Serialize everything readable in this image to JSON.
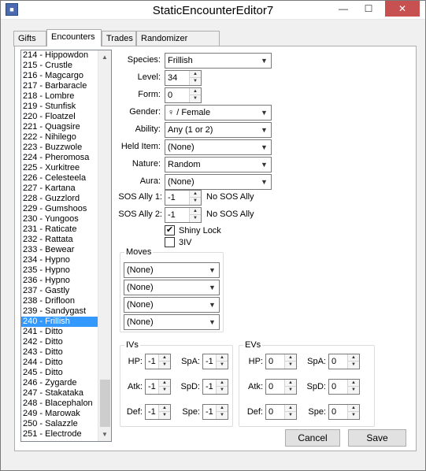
{
  "window": {
    "title": "StaticEncounterEditor7",
    "minimize": "—",
    "maximize": "☐",
    "close": "✕",
    "icon": "app-icon"
  },
  "tabs": [
    {
      "label": "Gifts"
    },
    {
      "label": "Encounters"
    },
    {
      "label": "Trades"
    },
    {
      "label": "Randomizer Options"
    }
  ],
  "encounter_list": [
    "214 - Hippowdon",
    "215 - Crustle",
    "216 - Magcargo",
    "217 - Barbaracle",
    "218 - Lombre",
    "219 - Stunfisk",
    "220 - Floatzel",
    "221 - Quagsire",
    "222 - Nihilego",
    "223 - Buzzwole",
    "224 - Pheromosa",
    "225 - Xurkitree",
    "226 - Celesteela",
    "227 - Kartana",
    "228 - Guzzlord",
    "229 - Gumshoos",
    "230 - Yungoos",
    "231 - Raticate",
    "232 - Rattata",
    "233 - Bewear",
    "234 - Hypno",
    "235 - Hypno",
    "236 - Hypno",
    "237 - Gastly",
    "238 - Drifloon",
    "239 - Sandygast",
    "240 - Frillish",
    "241 - Ditto",
    "242 - Ditto",
    "243 - Ditto",
    "244 - Ditto",
    "245 - Ditto",
    "246 - Zygarde",
    "247 - Stakataka",
    "248 - Blacephalon",
    "249 - Marowak",
    "250 - Salazzle",
    "251 - Electrode"
  ],
  "selected_index": 26,
  "form": {
    "species_label": "Species:",
    "species_value": "Frillish",
    "level_label": "Level:",
    "level_value": "34",
    "form_label": "Form:",
    "form_value": "0",
    "gender_label": "Gender:",
    "gender_value": "♀ / Female",
    "ability_label": "Ability:",
    "ability_value": "Any (1 or 2)",
    "held_item_label": "Held Item:",
    "held_item_value": "(None)",
    "nature_label": "Nature:",
    "nature_value": "Random",
    "aura_label": "Aura:",
    "aura_value": "(None)",
    "sos1_label": "SOS Ally 1:",
    "sos1_value": "-1",
    "sos1_text": "No SOS Ally",
    "sos2_label": "SOS Ally 2:",
    "sos2_value": "-1",
    "sos2_text": "No SOS Ally",
    "shiny_lock_label": "Shiny Lock",
    "shiny_lock_checked": true,
    "three_iv_label": "3IV",
    "three_iv_checked": false
  },
  "moves": {
    "label": "Moves",
    "values": [
      "(None)",
      "(None)",
      "(None)",
      "(None)"
    ]
  },
  "ivs": {
    "label": "IVs",
    "hp_label": "HP:",
    "hp": "-1",
    "atk_label": "Atk:",
    "atk": "-1",
    "def_label": "Def:",
    "def": "-1",
    "spa_label": "SpA:",
    "spa": "-1",
    "spd_label": "SpD:",
    "spd": "-1",
    "spe_label": "Spe:",
    "spe": "-1"
  },
  "evs": {
    "label": "EVs",
    "hp_label": "HP:",
    "hp": "0",
    "atk_label": "Atk:",
    "atk": "0",
    "def_label": "Def:",
    "def": "0",
    "spa_label": "SpA:",
    "spa": "0",
    "spd_label": "SpD:",
    "spd": "0",
    "spe_label": "Spe:",
    "spe": "0"
  },
  "buttons": {
    "cancel": "Cancel",
    "save": "Save"
  },
  "glyphs": {
    "dropdown": "▼",
    "up": "▲",
    "down": "▼",
    "check": "✔"
  }
}
